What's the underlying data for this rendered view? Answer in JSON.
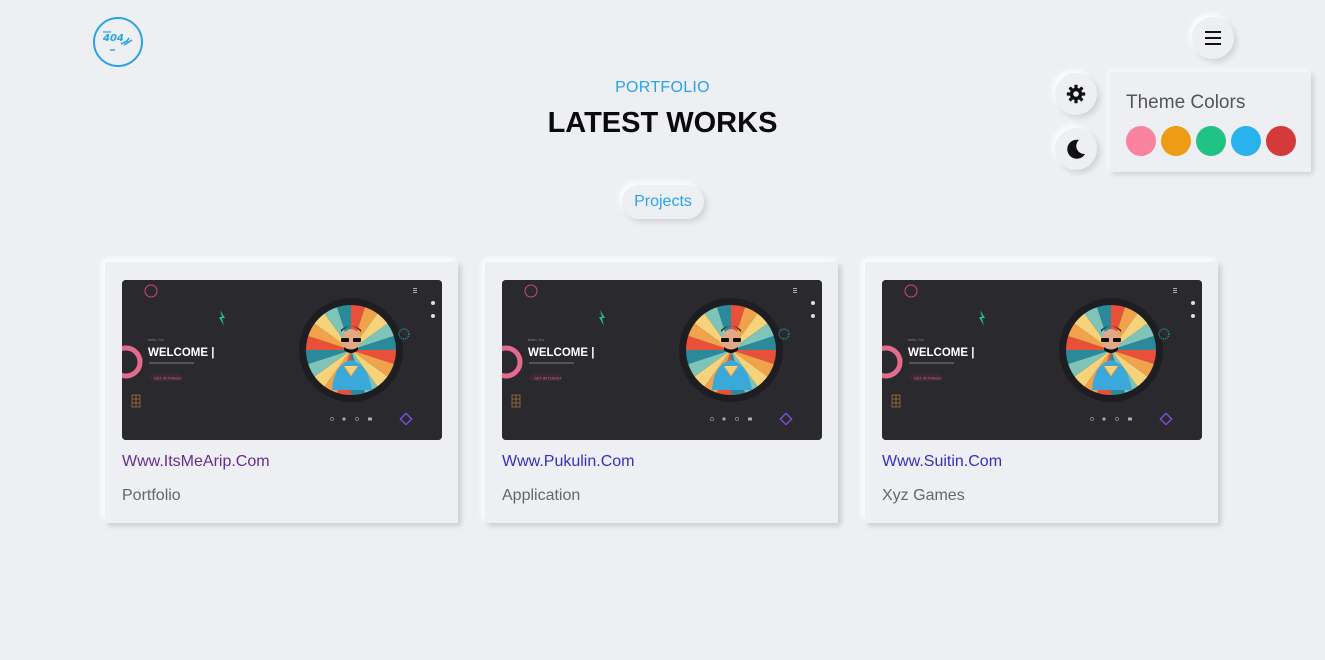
{
  "logo": {
    "text": "404",
    "icon": "logo-icon"
  },
  "menu": {
    "icon": "hamburger-icon"
  },
  "settings": {
    "icon": "gear-icon"
  },
  "dark_mode": {
    "icon": "moon-icon"
  },
  "theme": {
    "title": "Theme Colors",
    "colors": [
      "#f9839e",
      "#ee9b16",
      "#20c383",
      "#2ab2ed",
      "#d43a3a"
    ]
  },
  "header": {
    "subtitle": "PORTFOLIO",
    "title": "LATEST WORKS"
  },
  "filter": {
    "label": "Projects"
  },
  "projects": [
    {
      "link": "Www.ItsMeArip.Com",
      "category": "Portfolio",
      "link_color": "#6a2c8f"
    },
    {
      "link": "Www.Pukulin.Com",
      "category": "Application",
      "link_color": "#3630b8"
    },
    {
      "link": "Www.Suitin.Com",
      "category": "Xyz Games",
      "link_color": "#3630b8"
    }
  ],
  "thumbnail": {
    "welcome": "WELCOME |",
    "button": "GET IN TOUCH"
  }
}
